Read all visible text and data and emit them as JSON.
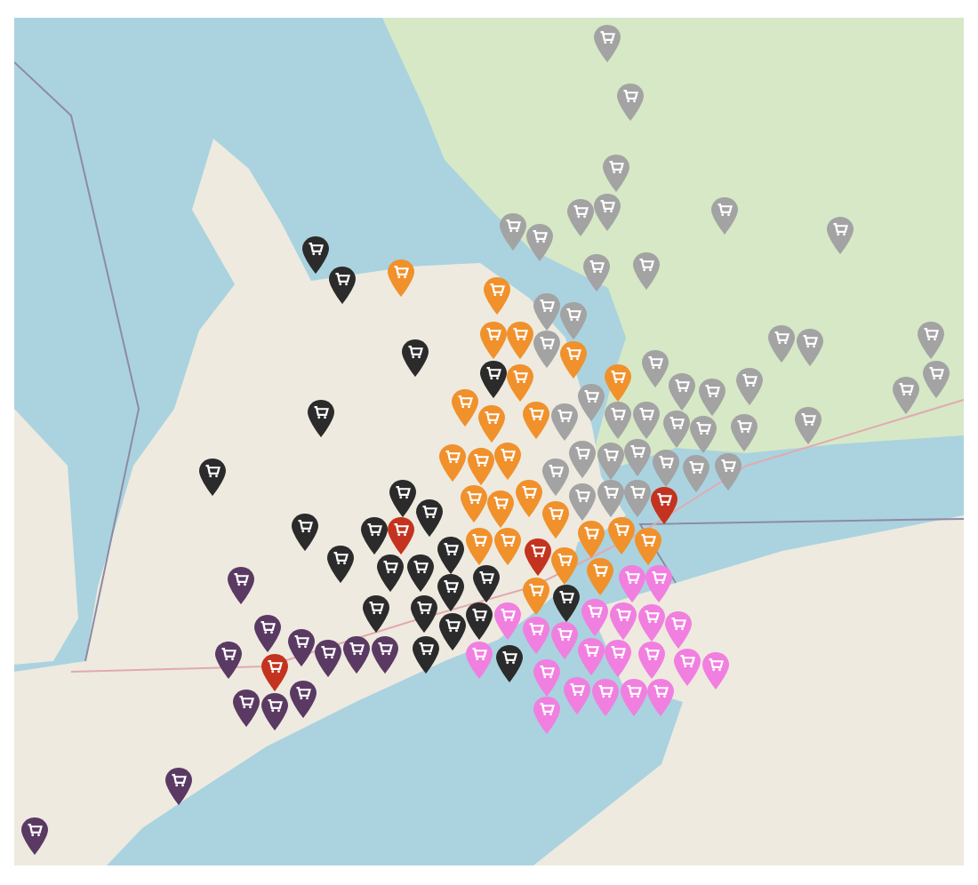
{
  "map": {
    "markers": [
      {
        "color": "#a3a3a3"
      },
      {
        "color": "#a3a3a3"
      },
      {
        "color": "#a3a3a3"
      },
      {
        "color": "#a3a3a3"
      },
      {
        "color": "#a3a3a3"
      },
      {
        "color": "#a3a3a3"
      },
      {
        "color": "#a3a3a3"
      },
      {
        "color": "#a3a3a3"
      },
      {
        "color": "#a3a3a3"
      },
      {
        "color": "#a3a3a3"
      },
      {
        "color": "#a3a3a3"
      },
      {
        "color": "#a3a3a3"
      },
      {
        "color": "#a3a3a3"
      },
      {
        "color": "#a3a3a3"
      },
      {
        "color": "#a3a3a3"
      },
      {
        "color": "#a3a3a3"
      },
      {
        "color": "#a3a3a3"
      },
      {
        "color": "#a3a3a3"
      },
      {
        "color": "#a3a3a3"
      },
      {
        "color": "#a3a3a3"
      },
      {
        "color": "#a3a3a3"
      },
      {
        "color": "#a3a3a3"
      },
      {
        "color": "#a3a3a3"
      },
      {
        "color": "#a3a3a3"
      },
      {
        "color": "#a3a3a3"
      },
      {
        "color": "#a3a3a3"
      },
      {
        "color": "#a3a3a3"
      },
      {
        "color": "#a3a3a3"
      },
      {
        "color": "#a3a3a3"
      },
      {
        "color": "#a3a3a3"
      },
      {
        "color": "#a3a3a3"
      },
      {
        "color": "#a3a3a3"
      },
      {
        "color": "#a3a3a3"
      },
      {
        "color": "#a3a3a3"
      },
      {
        "color": "#a3a3a3"
      },
      {
        "color": "#a3a3a3"
      },
      {
        "color": "#a3a3a3"
      },
      {
        "color": "#a3a3a3"
      },
      {
        "color": "#a3a3a3"
      },
      {
        "color": "#a3a3a3"
      },
      {
        "color": "#a3a3a3"
      },
      {
        "color": "#c4331f"
      },
      {
        "color": "#c4331f"
      },
      {
        "color": "#c4331f"
      },
      {
        "color": "#c4331f"
      },
      {
        "color": "#f0912c"
      },
      {
        "color": "#f0912c"
      },
      {
        "color": "#f0912c"
      },
      {
        "color": "#f0912c"
      },
      {
        "color": "#f0912c"
      },
      {
        "color": "#f0912c"
      },
      {
        "color": "#f0912c"
      },
      {
        "color": "#f0912c"
      },
      {
        "color": "#f0912c"
      },
      {
        "color": "#f0912c"
      },
      {
        "color": "#f0912c"
      },
      {
        "color": "#f0912c"
      },
      {
        "color": "#f0912c"
      },
      {
        "color": "#f0912c"
      },
      {
        "color": "#f0912c"
      },
      {
        "color": "#f0912c"
      },
      {
        "color": "#f0912c"
      },
      {
        "color": "#f0912c"
      },
      {
        "color": "#f0912c"
      },
      {
        "color": "#f0912c"
      },
      {
        "color": "#f0912c"
      },
      {
        "color": "#f0912c"
      },
      {
        "color": "#f0912c"
      },
      {
        "color": "#f0912c"
      },
      {
        "color": "#f0912c"
      },
      {
        "color": "#2b2b2b"
      },
      {
        "color": "#2b2b2b"
      },
      {
        "color": "#2b2b2b"
      },
      {
        "color": "#2b2b2b"
      },
      {
        "color": "#2b2b2b"
      },
      {
        "color": "#2b2b2b"
      },
      {
        "color": "#2b2b2b"
      },
      {
        "color": "#2b2b2b"
      },
      {
        "color": "#2b2b2b"
      },
      {
        "color": "#2b2b2b"
      },
      {
        "color": "#2b2b2b"
      },
      {
        "color": "#2b2b2b"
      },
      {
        "color": "#2b2b2b"
      },
      {
        "color": "#2b2b2b"
      },
      {
        "color": "#2b2b2b"
      },
      {
        "color": "#2b2b2b"
      },
      {
        "color": "#2b2b2b"
      },
      {
        "color": "#2b2b2b"
      },
      {
        "color": "#2b2b2b"
      },
      {
        "color": "#2b2b2b"
      },
      {
        "color": "#2b2b2b"
      },
      {
        "color": "#2b2b2b"
      },
      {
        "color": "#2b2b2b"
      },
      {
        "color": "#f17fe0"
      },
      {
        "color": "#f17fe0"
      },
      {
        "color": "#f17fe0"
      },
      {
        "color": "#f17fe0"
      },
      {
        "color": "#f17fe0"
      },
      {
        "color": "#f17fe0"
      },
      {
        "color": "#f17fe0"
      },
      {
        "color": "#f17fe0"
      },
      {
        "color": "#f17fe0"
      },
      {
        "color": "#f17fe0"
      },
      {
        "color": "#f17fe0"
      },
      {
        "color": "#f17fe0"
      },
      {
        "color": "#f17fe0"
      },
      {
        "color": "#f17fe0"
      },
      {
        "color": "#f17fe0"
      },
      {
        "color": "#f17fe0"
      },
      {
        "color": "#f17fe0"
      },
      {
        "color": "#f17fe0"
      },
      {
        "color": "#f17fe0"
      },
      {
        "color": "#f17fe0"
      },
      {
        "color": "#f17fe0"
      },
      {
        "color": "#5a3a63"
      },
      {
        "color": "#5a3a63"
      },
      {
        "color": "#5a3a63"
      },
      {
        "color": "#5a3a63"
      },
      {
        "color": "#5a3a63"
      },
      {
        "color": "#5a3a63"
      },
      {
        "color": "#5a3a63"
      },
      {
        "color": "#5a3a63"
      },
      {
        "color": "#5a3a63"
      },
      {
        "color": "#5a3a63"
      },
      {
        "color": "#5a3a63"
      },
      {
        "color": "#5a3a63"
      }
    ]
  }
}
